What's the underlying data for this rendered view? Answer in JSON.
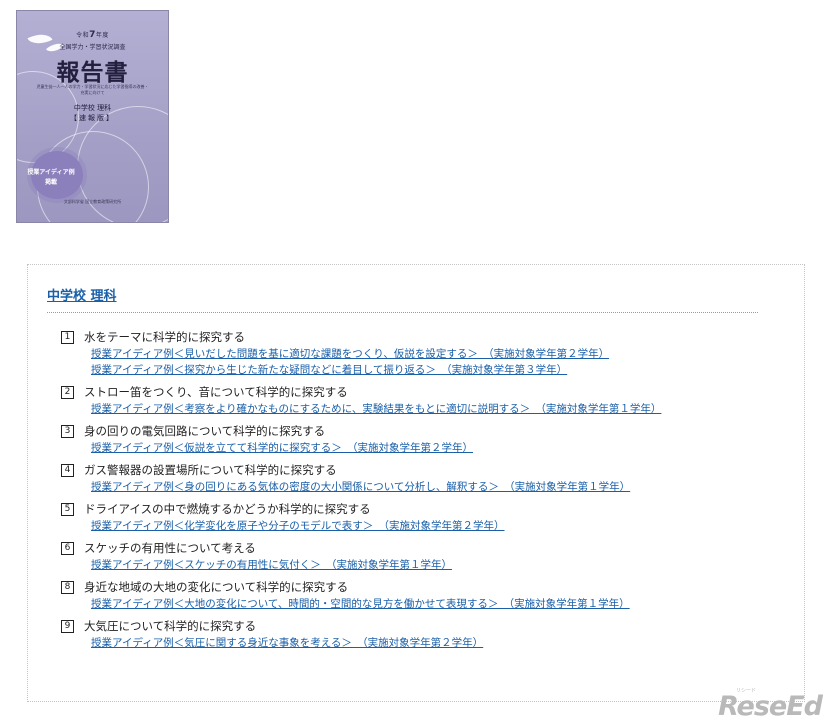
{
  "cover": {
    "era": "令和",
    "era_year": "7",
    "era_suffix": "年度",
    "survey": "全国学力・学習状況調査",
    "title": "報告書",
    "note": "児童生徒一人一人の学力・学習状況に応じた学習指導の改善・充実に向けて",
    "subject": "中学校 理科",
    "edition": "【速報版】",
    "badge_line1": "授業アイディア例",
    "badge_line2": "掲載",
    "publisher": "文部科学省 国立教育政策研究所",
    "colors": {
      "background": "#a39fc6",
      "badge": "#8c80bc"
    }
  },
  "section": {
    "title": "中学校 理科",
    "link_color": "#1a5fa8",
    "items": [
      {
        "num": "1",
        "title": "水をテーマに科学的に探究する",
        "links": [
          "授業アイディア例＜見いだした問題を基に適切な課題をつくり、仮説を設定する＞　（実施対象学年第２学年）",
          "授業アイディア例＜探究から生じた新たな疑問などに着目して振り返る＞　（実施対象学年第３学年）"
        ]
      },
      {
        "num": "2",
        "title": "ストロー笛をつくり、音について科学的に探究する",
        "links": [
          "授業アイディア例＜考察をより確かなものにするために、実験結果をもとに適切に説明する＞　（実施対象学年第１学年）"
        ]
      },
      {
        "num": "3",
        "title": "身の回りの電気回路について科学的に探究する",
        "links": [
          "授業アイディア例＜仮説を立てて科学的に探究する＞　（実施対象学年第２学年）"
        ]
      },
      {
        "num": "4",
        "title": "ガス警報器の設置場所について科学的に探究する",
        "links": [
          "授業アイディア例＜身の回りにある気体の密度の大小関係について分析し、解釈する＞　（実施対象学年第１学年）"
        ]
      },
      {
        "num": "5",
        "title": "ドライアイスの中で燃焼するかどうか科学的に探究する",
        "links": [
          "授業アイディア例＜化学変化を原子や分子のモデルで表す＞　（実施対象学年第２学年）"
        ]
      },
      {
        "num": "6",
        "title": "スケッチの有用性について考える",
        "links": [
          "授業アイディア例＜スケッチの有用性に気付く＞　（実施対象学年第１学年）"
        ]
      },
      {
        "num": "8",
        "title": "身近な地域の大地の変化について科学的に探究する",
        "links": [
          "授業アイディア例＜大地の変化について、時間的・空間的な見方を働かせて表現する＞　（実施対象学年第１学年）"
        ]
      },
      {
        "num": "9",
        "title": "大気圧について科学的に探究する",
        "links": [
          "授業アイディア例＜気圧に関する身近な事象を考える＞　（実施対象学年第２学年）"
        ]
      }
    ]
  },
  "watermark": {
    "text": "ReseEd",
    "ruby": "リシード"
  }
}
